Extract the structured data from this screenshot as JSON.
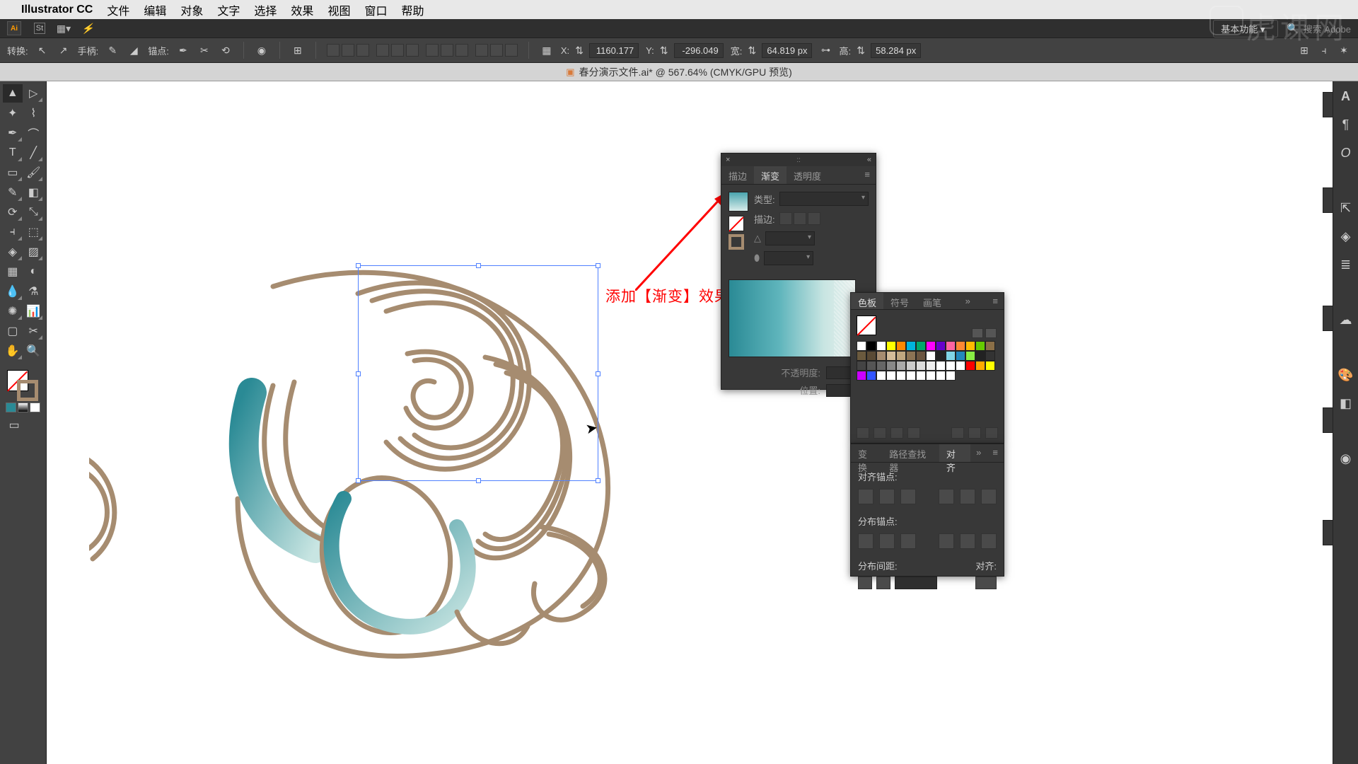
{
  "menubar": {
    "appname": "Illustrator CC",
    "items": [
      "文件",
      "编辑",
      "对象",
      "文字",
      "选择",
      "效果",
      "视图",
      "窗口",
      "帮助"
    ]
  },
  "appbar": {
    "workspace": "基本功能",
    "search_placeholder": "搜索 Adobe"
  },
  "controlbar": {
    "transform_label": "转换:",
    "handle_label": "手柄:",
    "anchor_label": "锚点:",
    "x_label": "X:",
    "x_value": "1160.177",
    "y_label": "Y:",
    "y_value": "-296.049",
    "w_label": "宽:",
    "w_value": "64.819 px",
    "h_label": "高:",
    "h_value": "58.284 px"
  },
  "doctab": {
    "title": "春分演示文件.ai* @ 567.64% (CMYK/GPU 预览)"
  },
  "annotation": {
    "text": "添加【渐变】效果"
  },
  "gradient_panel": {
    "tabs": [
      "描边",
      "渐变",
      "透明度"
    ],
    "active_tab": 1,
    "type_label": "类型:",
    "stroke_label": "描边:",
    "opacity_label": "不透明度:",
    "location_label": "位置:"
  },
  "swatches_panel": {
    "tabs": [
      "色板",
      "符号",
      "画笔"
    ],
    "active_tab": 0,
    "colors_row1": [
      "#ffffff",
      "#000000",
      "#ffffff",
      "#ffff00",
      "#ff8800",
      "#00b4dd",
      "#00a86b",
      "#ff00ff",
      "#6600cc",
      "#ff64a0",
      "#ff8833",
      "#ffbb00",
      "#66cc00"
    ],
    "colors_row2": [
      "#8b6f47",
      "#6b5a3e",
      "#5a4a35",
      "#a68c70",
      "#d4bc99",
      "#c0a780",
      "#8c7354",
      "#6b5540",
      "#ffffff",
      "#222222",
      "#80d5e5",
      "#2288bb",
      "#88ee44"
    ],
    "colors_row3": [
      "#222222",
      "#333333",
      "#444444",
      "#555555",
      "#666666",
      "#888888",
      "#aaaaaa",
      "#cccccc",
      "#dddddd",
      "#eeeeee",
      "#ffffff",
      "#ffffff",
      "#ffffff"
    ],
    "colors_row4": [
      "#ff0000",
      "#ffaa00",
      "#ffff00",
      "#cc00ff",
      "#3355ff",
      "#ffffff",
      "#ffffff",
      "#ffffff",
      "#ffffff",
      "#ffffff",
      "#ffffff",
      "#ffffff",
      "#ffffff"
    ]
  },
  "align_panel": {
    "tabs": [
      "变换",
      "路径查找器",
      "对齐"
    ],
    "active_tab": 2,
    "align_anchor_label": "对齐锚点:",
    "distribute_anchor_label": "分布锚点:",
    "distribute_spacing_label": "分布间距:",
    "align_to_label": "对齐:"
  },
  "watermark": "虎课网"
}
